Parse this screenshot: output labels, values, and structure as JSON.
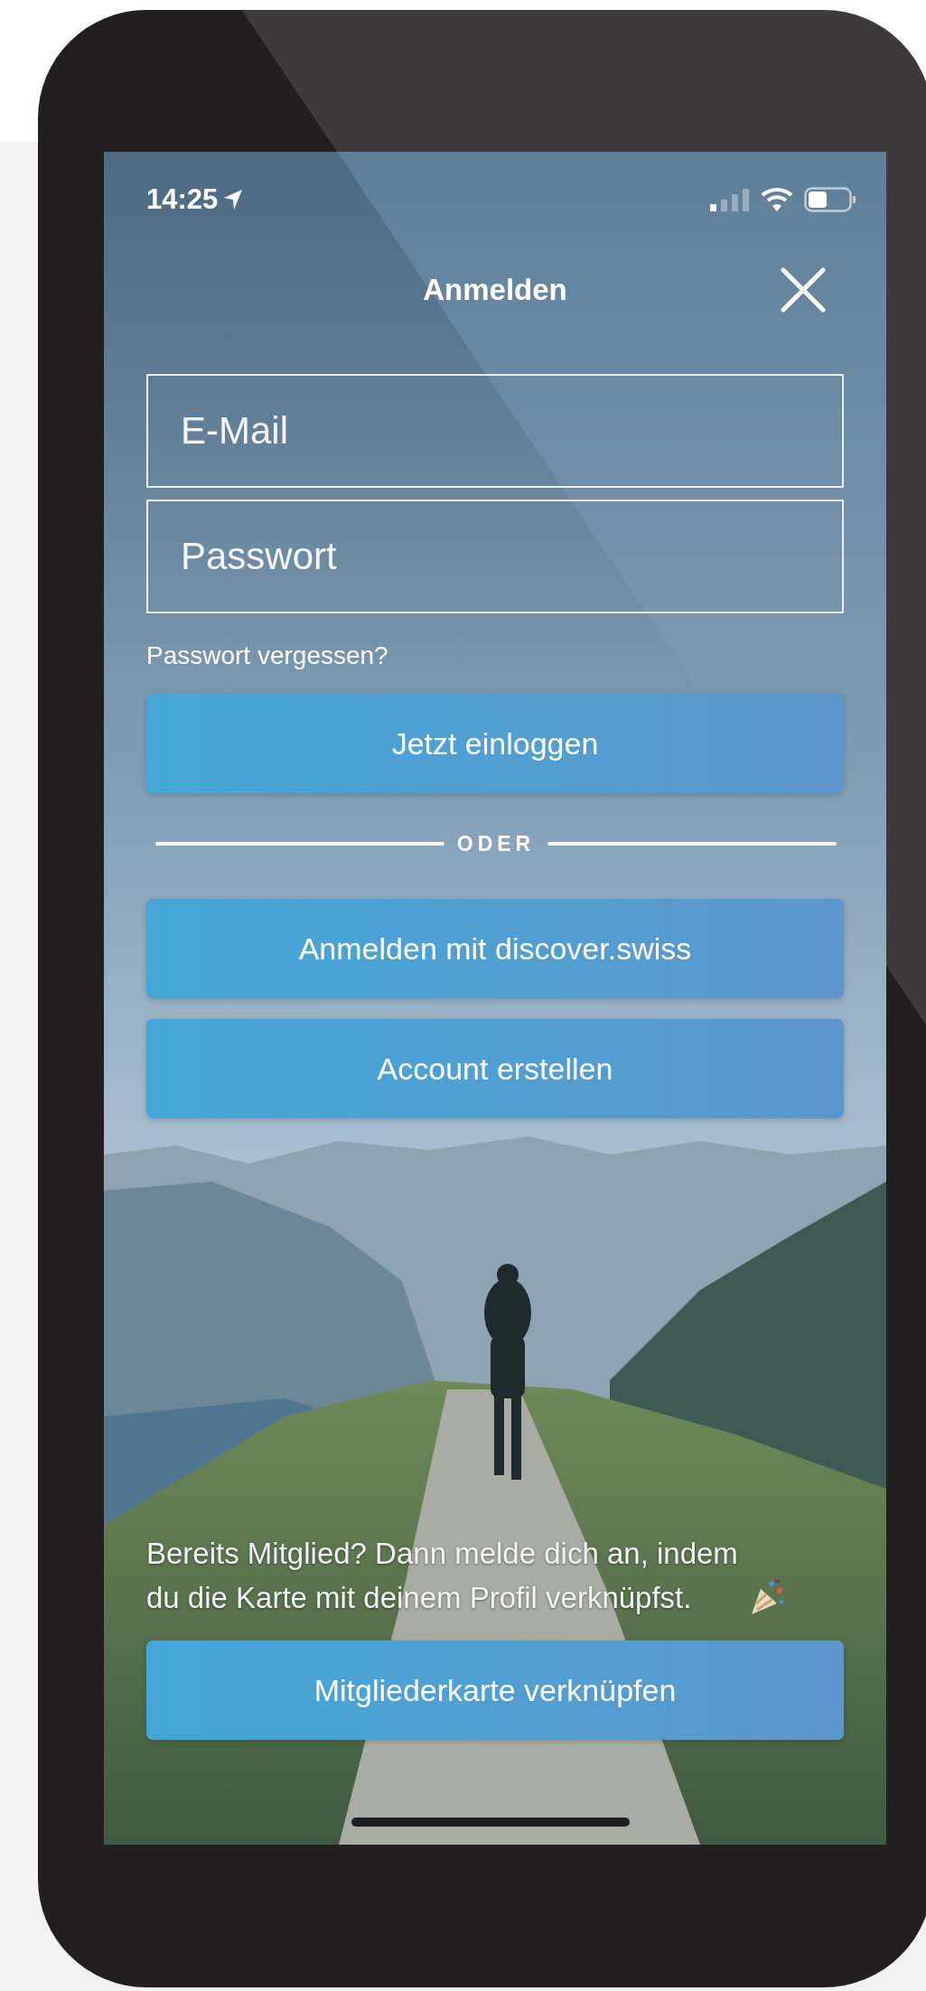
{
  "status_bar": {
    "time": "14:25"
  },
  "header": {
    "title": "Anmelden"
  },
  "fields": [
    {
      "placeholder": "E-Mail"
    },
    {
      "placeholder": "Passwort"
    }
  ],
  "forgot_link": "Passwort vergessen?",
  "login_button": "Jetzt einloggen",
  "divider": "ODER",
  "buttons": [
    "Anmelden mit discover.swiss",
    "Account erstellen"
  ],
  "member_text": "Bereits Mitglied? Dann melde dich an, indem du die Karte mit deinem Profil verknüpfst.",
  "member_button": "Mitgliederkarte verknüpfen"
}
